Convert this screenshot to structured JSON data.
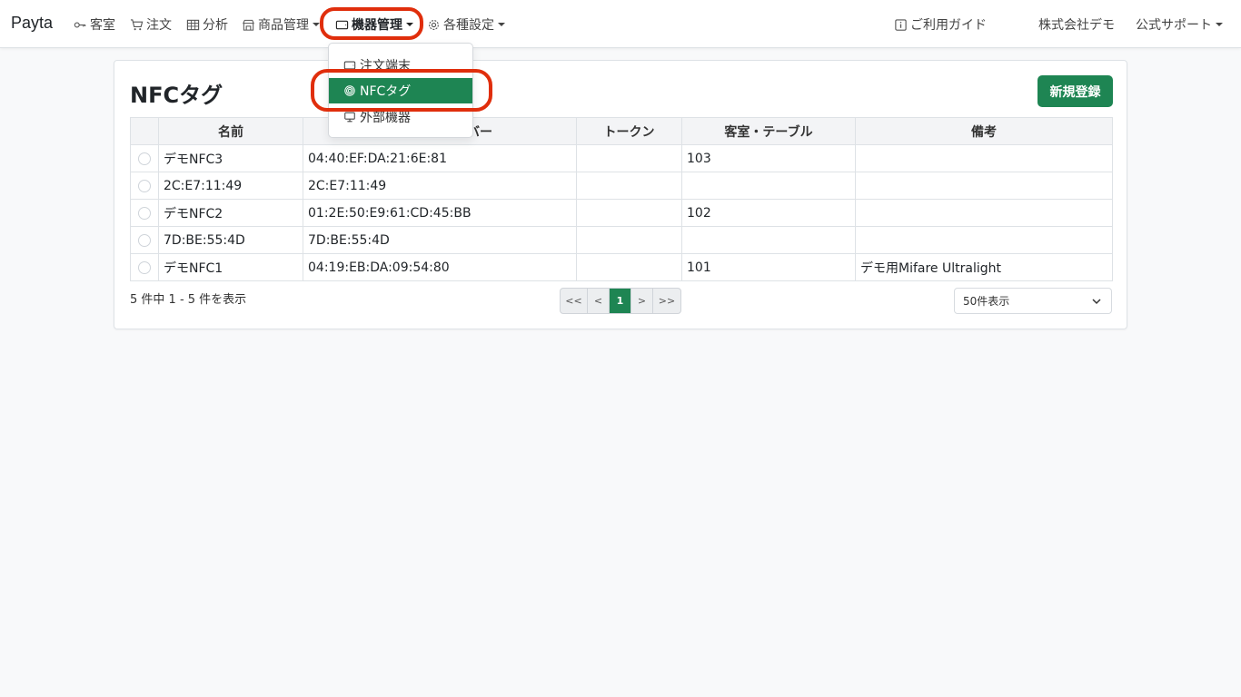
{
  "app": {
    "brand": "Payta"
  },
  "nav": {
    "items": [
      {
        "label": "客室",
        "icon": "key-icon"
      },
      {
        "label": "注文",
        "icon": "cart-icon"
      },
      {
        "label": "分析",
        "icon": "table-icon"
      },
      {
        "label": "商品管理",
        "icon": "shop-icon"
      },
      {
        "label": "機器管理",
        "icon": "device-icon"
      },
      {
        "label": "各種設定",
        "icon": "gear-icon"
      }
    ],
    "guide": "ご利用ガイド",
    "company": "株式会社デモ",
    "support": "公式サポート"
  },
  "dropdown": {
    "items": [
      {
        "label": "注文端末",
        "icon": "tablet-icon"
      },
      {
        "label": "NFCタグ",
        "icon": "nfc-icon"
      },
      {
        "label": "外部機器",
        "icon": "monitor-icon"
      }
    ]
  },
  "page": {
    "title": "NFCタグ",
    "new_button": "新規登録"
  },
  "table": {
    "headers": [
      "名前",
      "バー",
      "トークン",
      "客室・テーブル",
      "備考"
    ],
    "rows": [
      {
        "name": "デモNFC3",
        "serial": "04:40:EF:DA:21:6E:81",
        "token": "",
        "room": "103",
        "note": ""
      },
      {
        "name": "2C:E7:11:49",
        "serial": "2C:E7:11:49",
        "token": "",
        "room": "",
        "note": ""
      },
      {
        "name": "デモNFC2",
        "serial": "01:2E:50:E9:61:CD:45:BB",
        "token": "",
        "room": "102",
        "note": ""
      },
      {
        "name": "7D:BE:55:4D",
        "serial": "7D:BE:55:4D",
        "token": "",
        "room": "",
        "note": ""
      },
      {
        "name": "デモNFC1",
        "serial": "04:19:EB:DA:09:54:80",
        "token": "",
        "room": "101",
        "note": "デモ用Mifare Ultralight"
      }
    ]
  },
  "footer": {
    "count_text": "5 件中 1 - 5 件を表示",
    "pager": {
      "first": "<<",
      "prev": "<",
      "current": "1",
      "next": ">",
      "last": ">>"
    },
    "per_page": "50件表示"
  },
  "colors": {
    "accent": "#1e8553",
    "highlight": "#e02e0c"
  }
}
